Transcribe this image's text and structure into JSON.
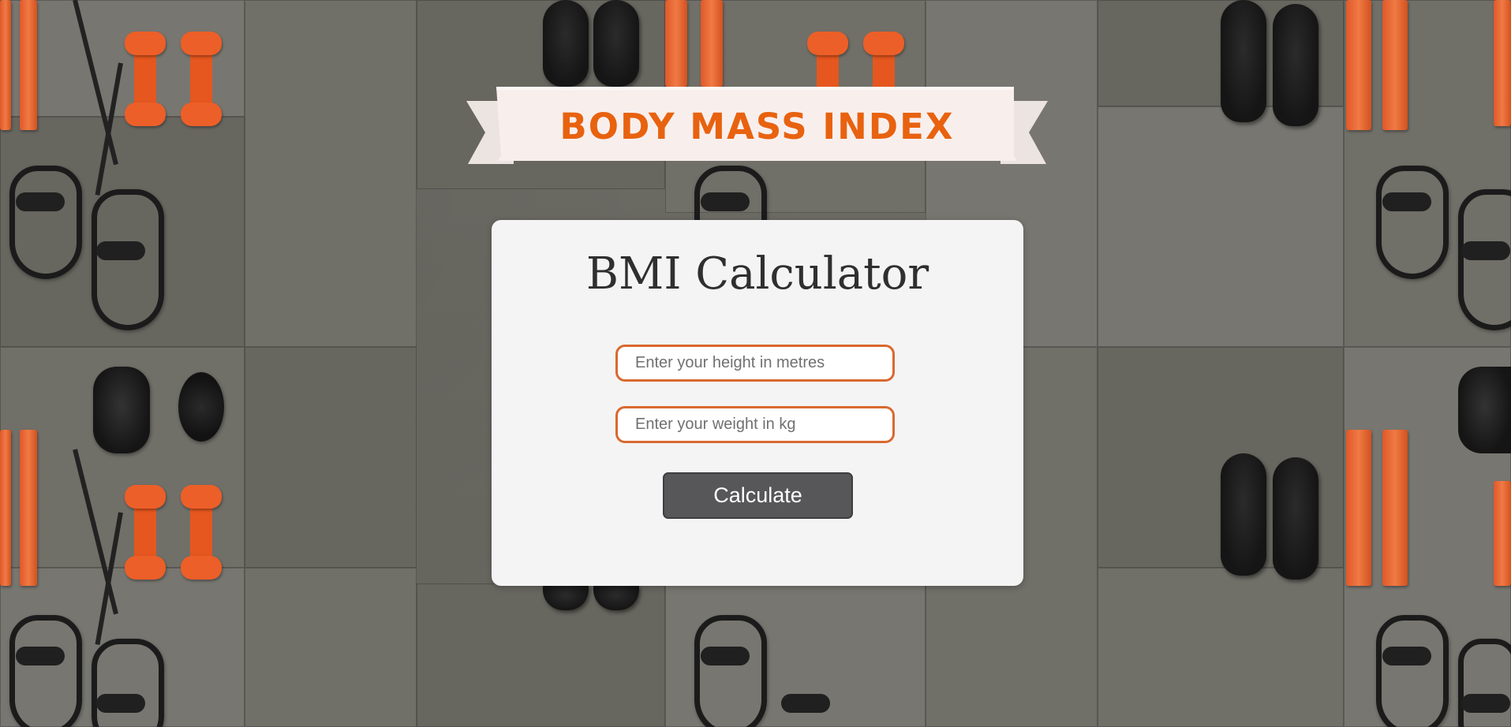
{
  "banner": {
    "title": "BODY MASS INDEX"
  },
  "calculator": {
    "title": "BMI Calculator",
    "height_input": {
      "value": "",
      "placeholder": "Enter your height in metres"
    },
    "weight_input": {
      "value": "",
      "placeholder": "Enter your weight in kg"
    },
    "calculate_label": "Calculate"
  },
  "colors": {
    "accent": "#e8620f",
    "input_border": "#d9692f",
    "button": "#575658",
    "card": "#f4f4f4",
    "banner_ribbon": "#f8efed"
  }
}
